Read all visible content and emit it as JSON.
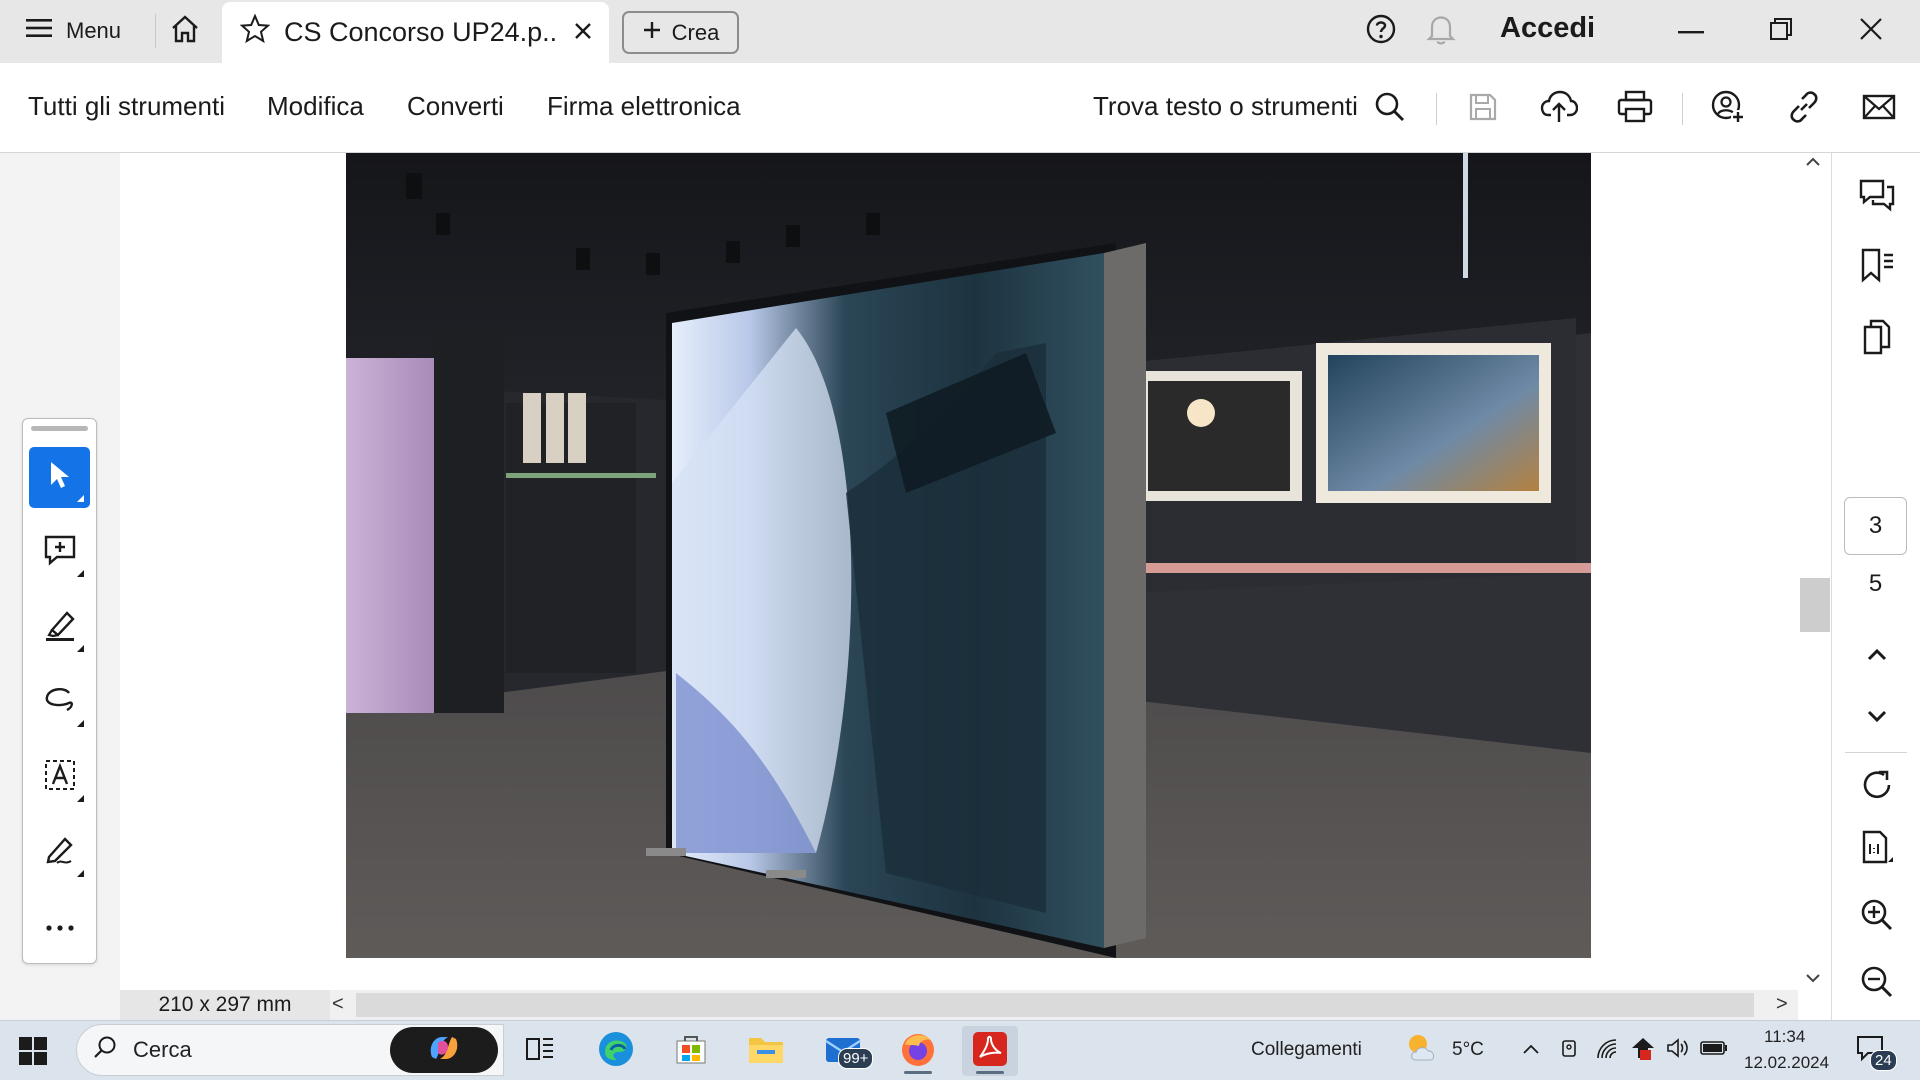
{
  "titlebar": {
    "menu_label": "Menu",
    "tab_title": "CS Concorso UP24.p...",
    "create_label": "Crea",
    "signin_label": "Accedi",
    "icons": [
      "hamburger-icon",
      "home-icon",
      "star-icon",
      "close-icon",
      "plus-icon",
      "help-icon",
      "bell-icon",
      "minimize-icon",
      "restore-icon",
      "close-window-icon"
    ]
  },
  "toolbar": {
    "menus": [
      "Tutti gli strumenti",
      "Modifica",
      "Converti",
      "Firma elettronica"
    ],
    "find_label": "Trova testo o strumenti",
    "icons": [
      "search-icon",
      "save-icon",
      "cloud-upload-icon",
      "print-icon",
      "share-user-icon",
      "link-icon",
      "mail-icon"
    ]
  },
  "left_tools": {
    "items": [
      "select-cursor-icon",
      "add-comment-icon",
      "highlight-pen-icon",
      "freehand-draw-icon",
      "text-box-icon",
      "signature-pen-icon",
      "more-icon"
    ],
    "more_label": "..."
  },
  "right_panel": {
    "current_page": "3",
    "total_pages": "5",
    "icons": [
      "comments-icon",
      "bookmarks-icon",
      "pages-icon",
      "page-up-icon",
      "page-down-icon",
      "rotate-icon",
      "actual-size-icon",
      "zoom-in-icon",
      "zoom-out-icon"
    ]
  },
  "status": {
    "page_size": "210 x 297 mm",
    "scroll_left": "<",
    "scroll_right": ">"
  },
  "taskbar": {
    "search_placeholder": "Cerca",
    "links_label": "Collegamenti",
    "temperature": "5°C",
    "time": "11:34",
    "date": "12.02.2024",
    "mail_badge": "99+",
    "notif_badge": "24",
    "apps": [
      "windows-start-icon",
      "copilot-icon",
      "task-view-icon",
      "edge-icon",
      "store-icon",
      "file-explorer-icon",
      "mail-icon",
      "firefox-icon",
      "acrobat-icon"
    ],
    "colors": {
      "accent": "#1473e6",
      "acrobat": "#d7261e"
    }
  }
}
